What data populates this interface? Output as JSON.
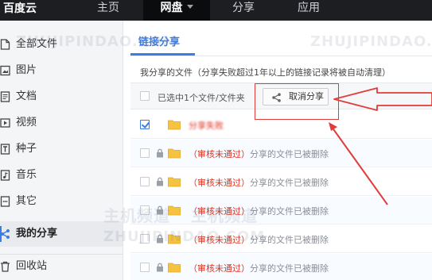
{
  "topnav": {
    "logo": "百度云",
    "items": [
      {
        "label": "主页"
      },
      {
        "label": "网盘"
      },
      {
        "label": "分享"
      },
      {
        "label": "应用"
      }
    ]
  },
  "sidebar": {
    "items": [
      {
        "label": "全部文件",
        "icon": "file-icon"
      },
      {
        "label": "图片",
        "icon": "image-icon"
      },
      {
        "label": "文档",
        "icon": "document-icon"
      },
      {
        "label": "视频",
        "icon": "video-icon"
      },
      {
        "label": "种子",
        "icon": "torrent-icon"
      },
      {
        "label": "音乐",
        "icon": "music-icon"
      },
      {
        "label": "其它",
        "icon": "other-icon"
      },
      {
        "label": "我的分享",
        "icon": "share-icon"
      },
      {
        "label": "回收站",
        "icon": "trash-icon"
      }
    ]
  },
  "main": {
    "tab": "链接分享",
    "description": "我分享的文件（分享失败超过1年以上的链接记录将被自动清理）",
    "selection": {
      "text": "已选中1个文件/文件夹",
      "cancel_label": "取消分享"
    },
    "rows": [
      {
        "status": "",
        "text": "分享失败"
      },
      {
        "status": "（审核未通过）",
        "text": "分享的文件已被删除"
      },
      {
        "status": "（审核未通过）",
        "text": "分享的文件已被删除"
      },
      {
        "status": "（审核未通过）",
        "text": "分享的文件已被删除"
      },
      {
        "status": "（审核未通过）",
        "text": "分享的文件已被删除"
      },
      {
        "status": "（审核未通过）",
        "text": "分享的文件已被删除"
      }
    ]
  },
  "watermarks": [
    "ZHUJIPINDAO.COM",
    "ZHUJIPINDAO.COM",
    "ZHUJIPINDAO.COM",
    "主机频道",
    "主机频道"
  ],
  "colors": {
    "accent": "#3b7ce5",
    "topbar": "#1c1e22",
    "annotation": "#e23b3b",
    "status_red": "#e0301e",
    "folder": "#f5c242"
  }
}
